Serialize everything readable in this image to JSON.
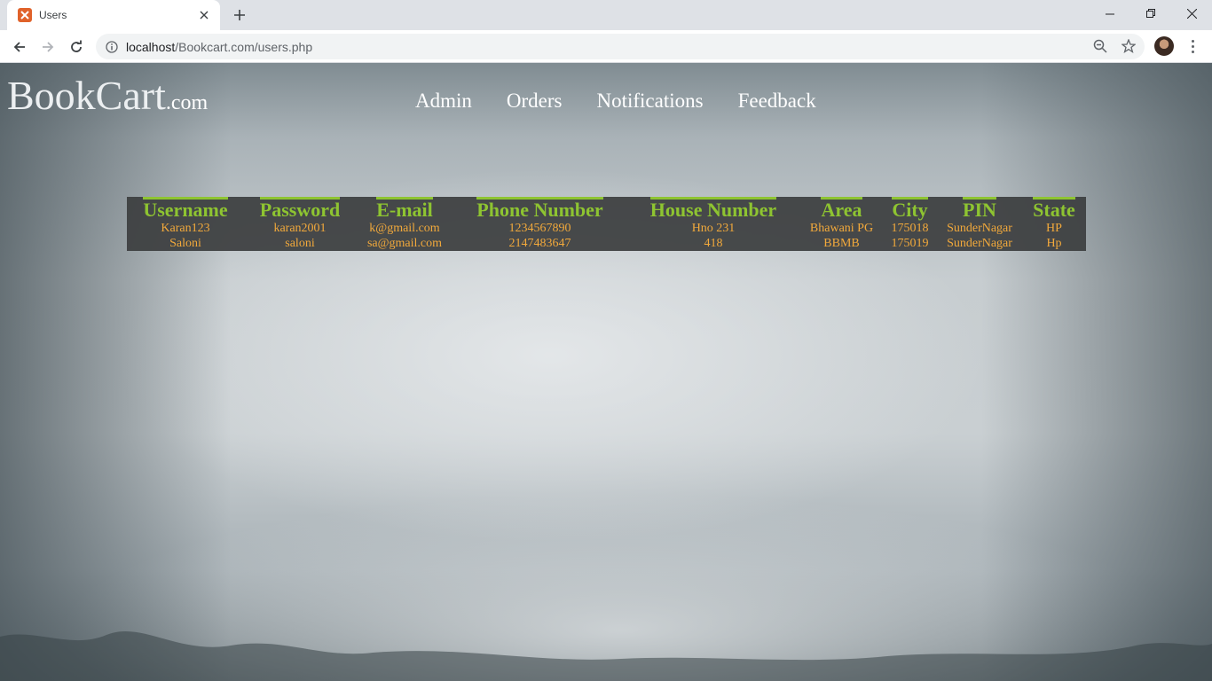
{
  "browser": {
    "tab_title": "Users",
    "url_host": "localhost",
    "url_path": "/Bookcart.com/users.php"
  },
  "site": {
    "logo_main": "BookCart",
    "logo_suffix": ".com",
    "nav": [
      "Admin",
      "Orders",
      "Notifications",
      "Feedback"
    ]
  },
  "table": {
    "headers": [
      "Username",
      "Password",
      "E-mail",
      "Phone Number",
      "House Number",
      "Area",
      "City",
      "PIN",
      "State"
    ],
    "rows": [
      [
        "Karan123",
        "karan2001",
        "k@gmail.com",
        "1234567890",
        "Hno 231",
        "Bhawani PG",
        "175018",
        "SunderNagar",
        "HP"
      ],
      [
        "Saloni",
        "saloni",
        "sa@gmail.com",
        "2147483647",
        "418",
        "BBMB",
        "175019",
        "SunderNagar",
        "Hp"
      ]
    ]
  },
  "colors": {
    "header_text": "#8ec431",
    "cell_text": "#f2a93b",
    "table_bg": "#3c3e40"
  }
}
